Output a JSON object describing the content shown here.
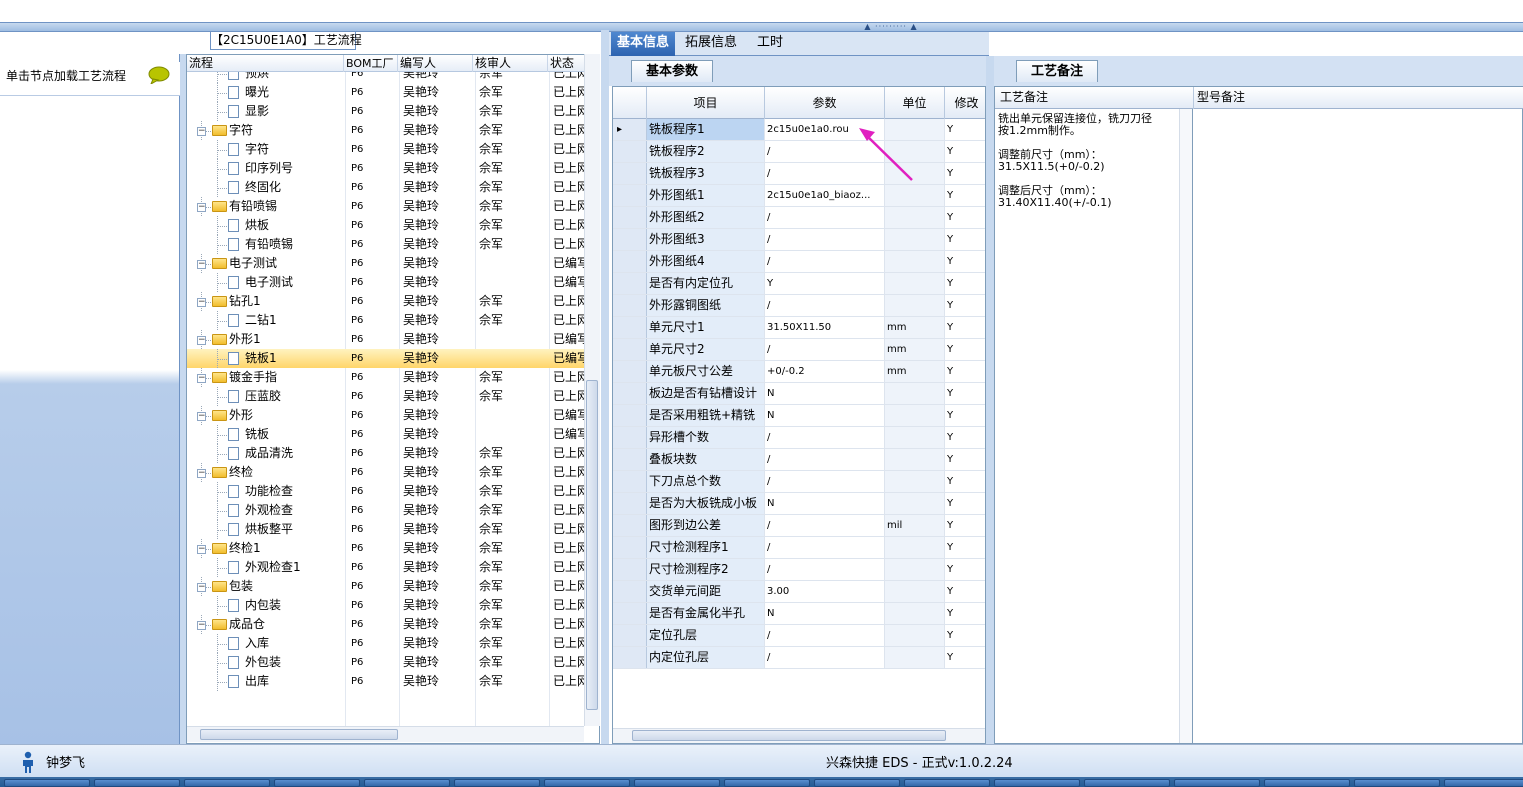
{
  "left": {
    "load_label": "单击节点加载工艺流程",
    "icon": "chat-bubble-icon"
  },
  "tree": {
    "title": "【2C15U0E1A0】工艺流程",
    "columns": [
      "流程",
      "BOM工厂",
      "编写人",
      "核审人",
      "状态"
    ],
    "rows": [
      {
        "level": 2,
        "type": "doc",
        "name": "预烘",
        "bom": "P6",
        "writer": "吴艳玲",
        "reviewer": "佘军",
        "status": "已上网"
      },
      {
        "level": 2,
        "type": "doc",
        "name": "曝光",
        "bom": "P6",
        "writer": "吴艳玲",
        "reviewer": "佘军",
        "status": "已上网"
      },
      {
        "level": 2,
        "type": "doc",
        "name": "显影",
        "bom": "P6",
        "writer": "吴艳玲",
        "reviewer": "佘军",
        "status": "已上网"
      },
      {
        "level": 1,
        "type": "folder",
        "name": "字符",
        "bom": "P6",
        "writer": "吴艳玲",
        "reviewer": "佘军",
        "status": "已上网"
      },
      {
        "level": 2,
        "type": "doc",
        "name": "字符",
        "bom": "P6",
        "writer": "吴艳玲",
        "reviewer": "佘军",
        "status": "已上网"
      },
      {
        "level": 2,
        "type": "doc",
        "name": "印序列号",
        "bom": "P6",
        "writer": "吴艳玲",
        "reviewer": "佘军",
        "status": "已上网"
      },
      {
        "level": 2,
        "type": "doc",
        "name": "终固化",
        "bom": "P6",
        "writer": "吴艳玲",
        "reviewer": "佘军",
        "status": "已上网"
      },
      {
        "level": 1,
        "type": "folder",
        "name": "有铅喷锡",
        "bom": "P6",
        "writer": "吴艳玲",
        "reviewer": "佘军",
        "status": "已上网"
      },
      {
        "level": 2,
        "type": "doc",
        "name": "烘板",
        "bom": "P6",
        "writer": "吴艳玲",
        "reviewer": "佘军",
        "status": "已上网"
      },
      {
        "level": 2,
        "type": "doc",
        "name": "有铅喷锡",
        "bom": "P6",
        "writer": "吴艳玲",
        "reviewer": "佘军",
        "status": "已上网"
      },
      {
        "level": 1,
        "type": "folder",
        "name": "电子测试",
        "bom": "P6",
        "writer": "吴艳玲",
        "reviewer": "",
        "status": "已编写"
      },
      {
        "level": 2,
        "type": "doc",
        "name": "电子测试",
        "bom": "P6",
        "writer": "吴艳玲",
        "reviewer": "",
        "status": "已编写"
      },
      {
        "level": 1,
        "type": "folder",
        "name": "钻孔1",
        "bom": "P6",
        "writer": "吴艳玲",
        "reviewer": "佘军",
        "status": "已上网"
      },
      {
        "level": 2,
        "type": "doc",
        "name": "二钻1",
        "bom": "P6",
        "writer": "吴艳玲",
        "reviewer": "佘军",
        "status": "已上网"
      },
      {
        "level": 1,
        "type": "folder",
        "name": "外形1",
        "bom": "P6",
        "writer": "吴艳玲",
        "reviewer": "",
        "status": "已编写"
      },
      {
        "level": 2,
        "type": "doc",
        "name": "铣板1",
        "bom": "P6",
        "writer": "吴艳玲",
        "reviewer": "",
        "status": "已编写",
        "selected": true
      },
      {
        "level": 1,
        "type": "folder",
        "name": "镀金手指",
        "bom": "P6",
        "writer": "吴艳玲",
        "reviewer": "佘军",
        "status": "已上网"
      },
      {
        "level": 2,
        "type": "doc",
        "name": "压蓝胶",
        "bom": "P6",
        "writer": "吴艳玲",
        "reviewer": "佘军",
        "status": "已上网"
      },
      {
        "level": 1,
        "type": "folder",
        "name": "外形",
        "bom": "P6",
        "writer": "吴艳玲",
        "reviewer": "",
        "status": "已编写"
      },
      {
        "level": 2,
        "type": "doc",
        "name": "铣板",
        "bom": "P6",
        "writer": "吴艳玲",
        "reviewer": "",
        "status": "已编写"
      },
      {
        "level": 2,
        "type": "doc",
        "name": "成品清洗",
        "bom": "P6",
        "writer": "吴艳玲",
        "reviewer": "佘军",
        "status": "已上网"
      },
      {
        "level": 1,
        "type": "folder",
        "name": "终检",
        "bom": "P6",
        "writer": "吴艳玲",
        "reviewer": "佘军",
        "status": "已上网"
      },
      {
        "level": 2,
        "type": "doc",
        "name": "功能检查",
        "bom": "P6",
        "writer": "吴艳玲",
        "reviewer": "佘军",
        "status": "已上网"
      },
      {
        "level": 2,
        "type": "doc",
        "name": "外观检查",
        "bom": "P6",
        "writer": "吴艳玲",
        "reviewer": "佘军",
        "status": "已上网"
      },
      {
        "level": 2,
        "type": "doc",
        "name": "烘板整平",
        "bom": "P6",
        "writer": "吴艳玲",
        "reviewer": "佘军",
        "status": "已上网"
      },
      {
        "level": 1,
        "type": "folder",
        "name": "终检1",
        "bom": "P6",
        "writer": "吴艳玲",
        "reviewer": "佘军",
        "status": "已上网"
      },
      {
        "level": 2,
        "type": "doc",
        "name": "外观检查1",
        "bom": "P6",
        "writer": "吴艳玲",
        "reviewer": "佘军",
        "status": "已上网"
      },
      {
        "level": 1,
        "type": "folder",
        "name": "包装",
        "bom": "P6",
        "writer": "吴艳玲",
        "reviewer": "佘军",
        "status": "已上网"
      },
      {
        "level": 2,
        "type": "doc",
        "name": "内包装",
        "bom": "P6",
        "writer": "吴艳玲",
        "reviewer": "佘军",
        "status": "已上网"
      },
      {
        "level": 1,
        "type": "folder",
        "name": "成品仓",
        "bom": "P6",
        "writer": "吴艳玲",
        "reviewer": "佘军",
        "status": "已上网"
      },
      {
        "level": 2,
        "type": "doc",
        "name": "入库",
        "bom": "P6",
        "writer": "吴艳玲",
        "reviewer": "佘军",
        "status": "已上网"
      },
      {
        "level": 2,
        "type": "doc",
        "name": "外包装",
        "bom": "P6",
        "writer": "吴艳玲",
        "reviewer": "佘军",
        "status": "已上网"
      },
      {
        "level": 2,
        "type": "doc",
        "name": "出库",
        "bom": "P6",
        "writer": "吴艳玲",
        "reviewer": "佘军",
        "status": "已上网"
      }
    ]
  },
  "middle": {
    "tabs": [
      "基本信息",
      "拓展信息",
      "工时"
    ],
    "subtab": "基本参数",
    "columns": [
      "项目",
      "参数",
      "单位",
      "修改"
    ],
    "rows": [
      {
        "item": "铣板程序1",
        "param": "2c15u0e1a0.rou",
        "unit": "",
        "mod": "Y"
      },
      {
        "item": "铣板程序2",
        "param": "/",
        "unit": "",
        "mod": "Y"
      },
      {
        "item": "铣板程序3",
        "param": "/",
        "unit": "",
        "mod": "Y"
      },
      {
        "item": "外形图纸1",
        "param": "2c15u0e1a0_biaoz...",
        "unit": "",
        "mod": "Y"
      },
      {
        "item": "外形图纸2",
        "param": "/",
        "unit": "",
        "mod": "Y"
      },
      {
        "item": "外形图纸3",
        "param": "/",
        "unit": "",
        "mod": "Y"
      },
      {
        "item": "外形图纸4",
        "param": "/",
        "unit": "",
        "mod": "Y"
      },
      {
        "item": "是否有内定位孔",
        "param": "Y",
        "unit": "",
        "mod": "Y"
      },
      {
        "item": "外形露铜图纸",
        "param": "/",
        "unit": "",
        "mod": "Y"
      },
      {
        "item": "单元尺寸1",
        "param": "31.50X11.50",
        "unit": "mm",
        "mod": "Y"
      },
      {
        "item": "单元尺寸2",
        "param": "/",
        "unit": "mm",
        "mod": "Y"
      },
      {
        "item": "单元板尺寸公差",
        "param": "+0/-0.2",
        "unit": "mm",
        "mod": "Y"
      },
      {
        "item": "板边是否有钻槽设计",
        "param": "N",
        "unit": "",
        "mod": "Y"
      },
      {
        "item": "是否采用粗铣+精铣",
        "param": "N",
        "unit": "",
        "mod": "Y"
      },
      {
        "item": "异形槽个数",
        "param": "/",
        "unit": "",
        "mod": "Y"
      },
      {
        "item": "叠板块数",
        "param": "/",
        "unit": "",
        "mod": "Y"
      },
      {
        "item": "下刀点总个数",
        "param": "/",
        "unit": "",
        "mod": "Y"
      },
      {
        "item": "是否为大板铣成小板",
        "param": "N",
        "unit": "",
        "mod": "Y"
      },
      {
        "item": "图形到边公差",
        "param": "/",
        "unit": "mil",
        "mod": "Y"
      },
      {
        "item": "尺寸检测程序1",
        "param": "/",
        "unit": "",
        "mod": "Y"
      },
      {
        "item": "尺寸检测程序2",
        "param": "/",
        "unit": "",
        "mod": "Y"
      },
      {
        "item": "交货单元间距",
        "param": "3.00",
        "unit": "",
        "mod": "Y"
      },
      {
        "item": "是否有金属化半孔",
        "param": "N",
        "unit": "",
        "mod": "Y"
      },
      {
        "item": "定位孔层",
        "param": "/",
        "unit": "",
        "mod": "Y"
      },
      {
        "item": "内定位孔层",
        "param": "/",
        "unit": "",
        "mod": "Y"
      }
    ]
  },
  "right": {
    "tab": "工艺备注",
    "col_process_remark": "工艺备注",
    "col_model_remark": "型号备注",
    "remark_text": "铣出单元保留连接位，铣刀刀径\n按1.2mm制作。\n\n调整前尺寸（mm）：\n31.5X11.5(+0/-0.2)\n\n调整后尺寸（mm）：\n31.40X11.40(+/-0.1)"
  },
  "status": {
    "user": "钟梦飞",
    "version": "兴森快捷 EDS - 正式v:1.0.2.24"
  },
  "colors": {
    "accent": "#2d63b0",
    "selection": "#ffd56a",
    "annotation_arrow": "#e020c0"
  }
}
